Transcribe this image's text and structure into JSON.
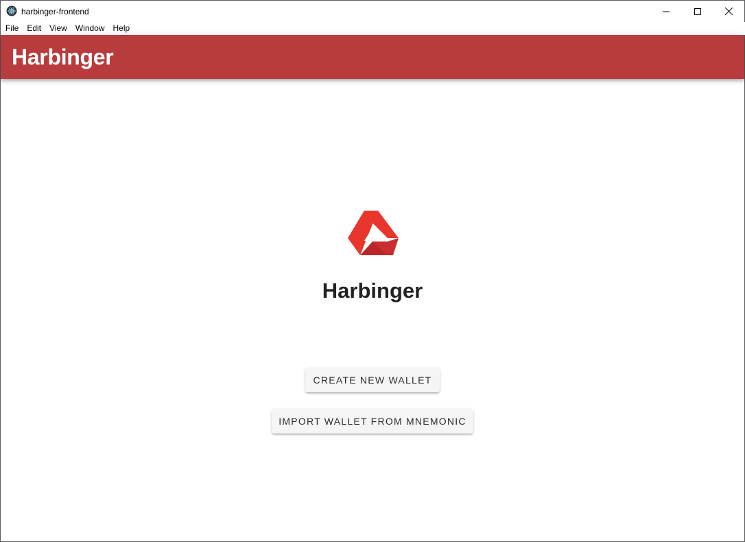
{
  "window": {
    "title": "harbinger-frontend",
    "icon": "electron-app-icon",
    "controls": {
      "minimize": "minimize-icon",
      "maximize": "maximize-icon",
      "close": "close-icon"
    }
  },
  "menubar": {
    "items": [
      "File",
      "Edit",
      "View",
      "Window",
      "Help"
    ]
  },
  "appbar": {
    "title": "Harbinger",
    "color": "#b83c3e"
  },
  "main": {
    "logo": "harbinger-logo",
    "heading": "Harbinger",
    "buttons": {
      "create": "CREATE NEW WALLET",
      "import": "IMPORT WALLET FROM MNEMONIC"
    }
  },
  "colors": {
    "logo_primary": "#e8362d",
    "logo_shadow": "#b9262a",
    "button_bg": "#f5f5f5"
  }
}
